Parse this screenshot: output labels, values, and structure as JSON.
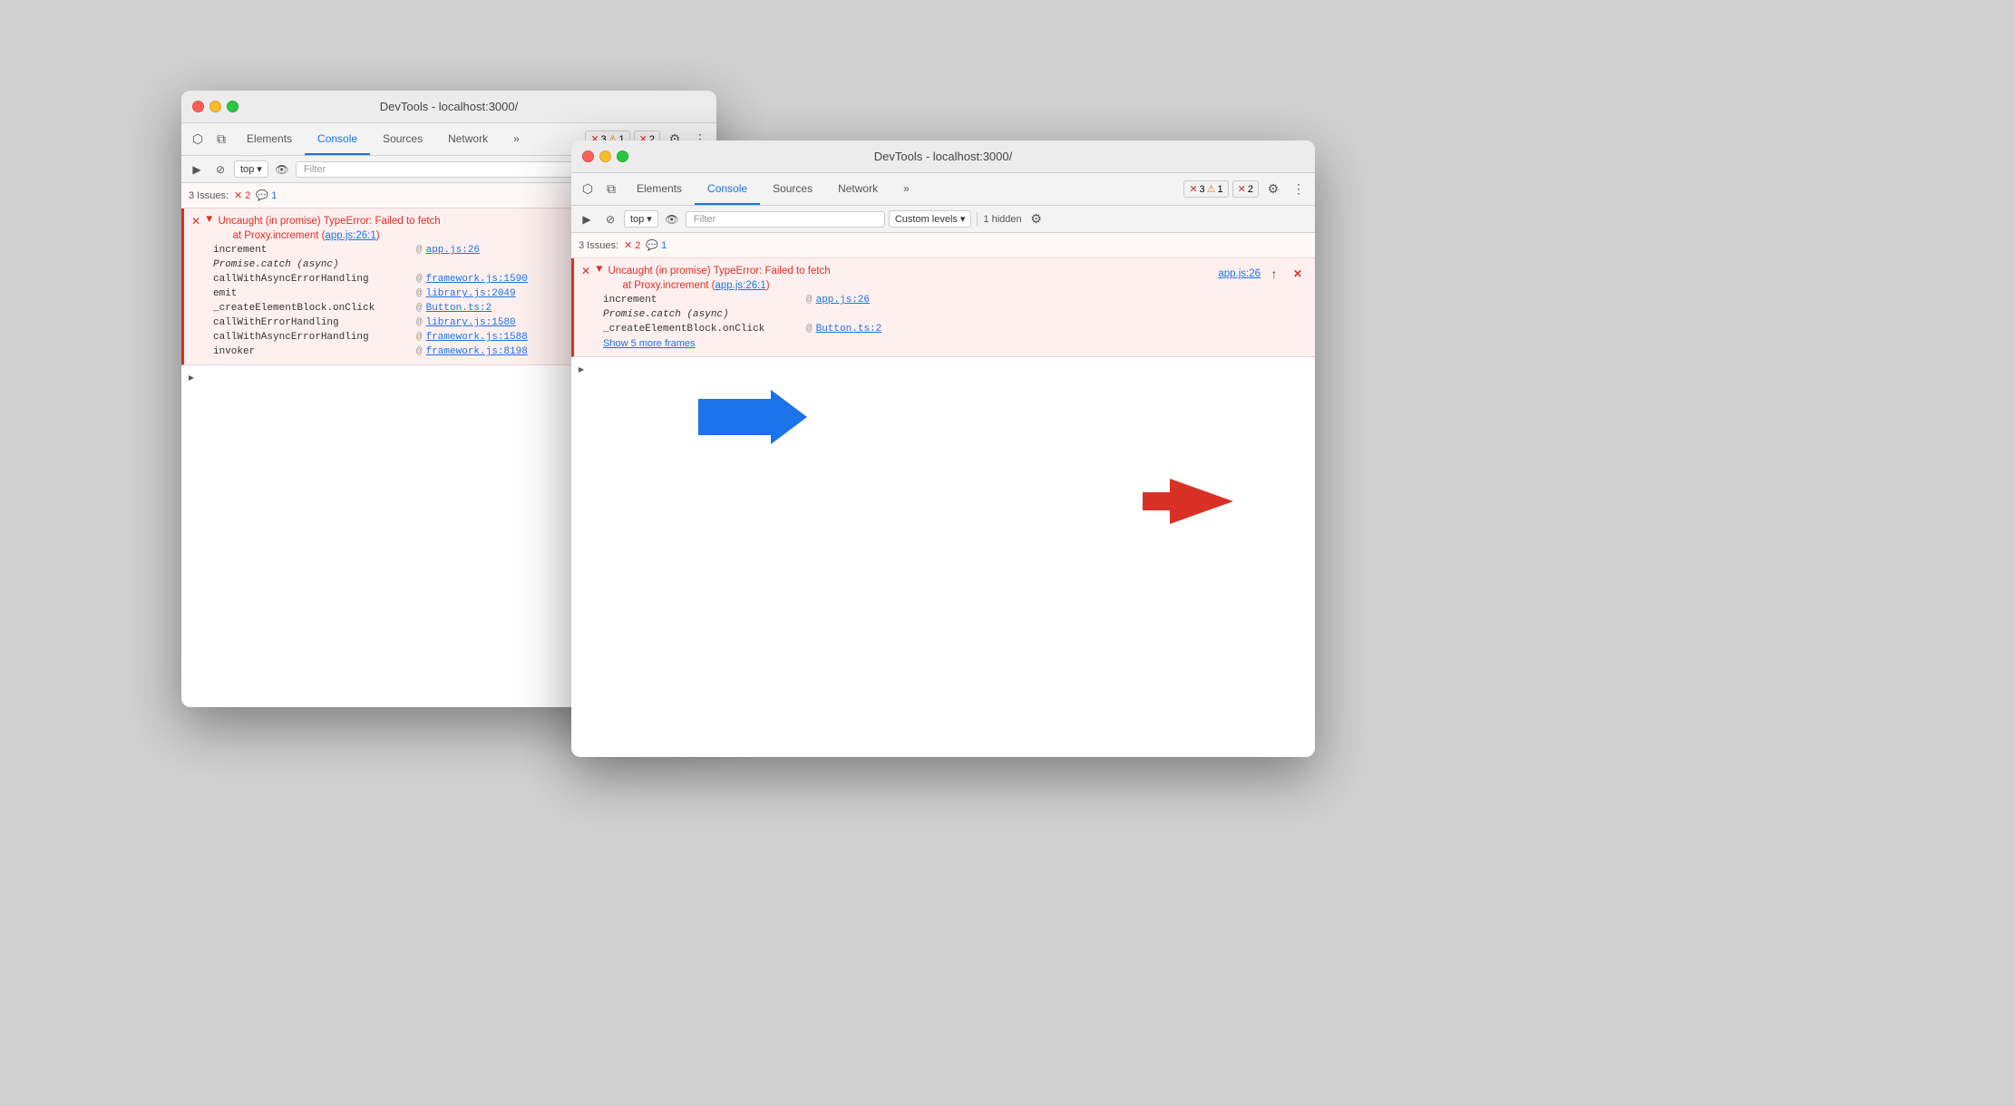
{
  "window_behind": {
    "title": "DevTools - localhost:3000/",
    "tabs": [
      "Elements",
      "Console",
      "Sources",
      "Network"
    ],
    "active_tab": "Console",
    "errors_badge": "✕ 3",
    "warnings_badge": "⚠ 1",
    "info_badge": "✕ 2",
    "top_label": "top",
    "filter_placeholder": "Filter",
    "issues_label": "3 Issues:",
    "issues_errors": "✕ 2",
    "issues_info": "💬 1",
    "error_message_line1": "Uncaught (in promise) TypeError: Failed to fetch",
    "error_message_line2": "    at Proxy.increment (app.js:26:1)",
    "stack": [
      {
        "name": "increment",
        "at": "@",
        "link": "app.js:26",
        "italic": false
      },
      {
        "name": "Promise.catch (async)",
        "italic": true
      },
      {
        "name": "callWithAsyncErrorHandling",
        "at": "@",
        "link": "framework.js:1590",
        "italic": false
      },
      {
        "name": "emit",
        "at": "@",
        "link": "library.js:2049",
        "italic": false
      },
      {
        "name": "_createElementBlock.onClick",
        "at": "@",
        "link": "Button.ts:2",
        "italic": false
      },
      {
        "name": "callWithErrorHandling",
        "at": "@",
        "link": "library.js:1580",
        "italic": false
      },
      {
        "name": "callWithAsyncErrorHandling",
        "at": "@",
        "link": "framework.js:1588",
        "italic": false
      },
      {
        "name": "invoker",
        "at": "@",
        "link": "framework.js:8198",
        "italic": false
      }
    ]
  },
  "window_front": {
    "title": "DevTools - localhost:3000/",
    "tabs": [
      "Elements",
      "Console",
      "Sources",
      "Network"
    ],
    "active_tab": "Console",
    "errors_badge": "✕ 3",
    "warnings_badge": "⚠ 1",
    "info_badge": "✕ 2",
    "top_label": "top",
    "filter_placeholder": "Filter",
    "custom_levels_label": "Custom levels",
    "hidden_label": "1 hidden",
    "issues_label": "3 Issues:",
    "issues_errors": "✕ 2",
    "issues_info": "💬 1",
    "error_message_line1": "Uncaught (in promise) TypeError: Failed to fetch",
    "error_message_line2": "    at Proxy.increment (app.js:26:1)",
    "error_link_text": "app.js:26",
    "stack": [
      {
        "name": "increment",
        "at": "@",
        "link": "app.js:26",
        "italic": false
      },
      {
        "name": "Promise.catch (async)",
        "italic": true
      },
      {
        "name": "_createElementBlock.onClick",
        "at": "@",
        "link": "Button.ts:2",
        "italic": false
      }
    ],
    "show_more_text": "Show 5 more frames"
  },
  "icons": {
    "cursor": "⬡",
    "layers": "⧉",
    "play": "▶",
    "ban": "⊘",
    "eye": "👁",
    "gear": "⚙",
    "more": "⋮",
    "chevron_down": "▾",
    "chevron_right": "▸",
    "triangle_down": "▼",
    "close_x": "✕",
    "warning": "⚠",
    "info": "💬",
    "refresh": "↑"
  }
}
